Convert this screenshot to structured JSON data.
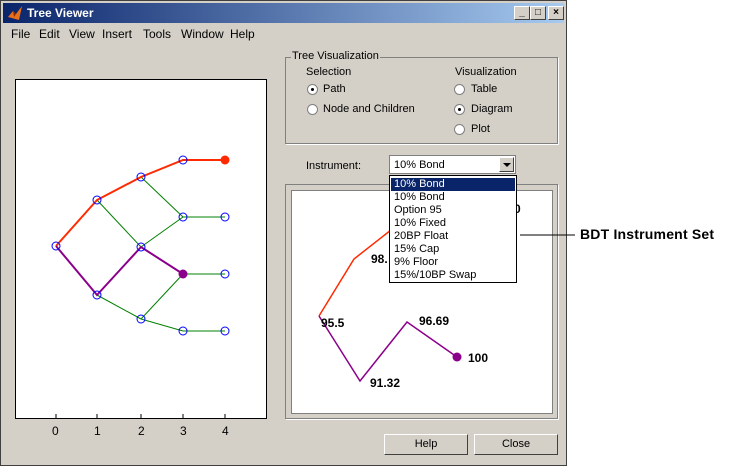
{
  "window": {
    "title": "Tree Viewer",
    "controls": [
      "_",
      "□",
      "×"
    ]
  },
  "menu": [
    "File",
    "Edit",
    "View",
    "Insert",
    "Tools",
    "Window",
    "Help"
  ],
  "tree_visualization": {
    "title": "Tree Visualization",
    "selection": {
      "label": "Selection",
      "options": [
        "Path",
        "Node and Children"
      ],
      "selected": "Path"
    },
    "visualization": {
      "label": "Visualization",
      "options": [
        "Table",
        "Diagram",
        "Plot"
      ],
      "selected": "Diagram"
    }
  },
  "instrument": {
    "label": "Instrument:",
    "value": "10% Bond",
    "options": [
      "10% Bond",
      "10% Bond",
      "Option 95",
      "10% Fixed",
      "20BP Float",
      "15% Cap",
      "9% Floor",
      "15%/10BP Swap"
    ],
    "highlighted_index": 0
  },
  "tree_plot": {
    "x_ticks": [
      "0",
      "1",
      "2",
      "3",
      "4"
    ]
  },
  "path_diagram": {
    "labels": [
      "95.5",
      "98.",
      "0",
      "91.32",
      "96.69",
      "100"
    ]
  },
  "buttons": {
    "help": "Help",
    "close": "Close"
  },
  "callout": "BDT Instrument Set",
  "colors": {
    "title_gradient_start": "#0a246a",
    "title_gradient_end": "#a6caf0",
    "window_face": "#d4d0c8",
    "path_red": "#ff2a00",
    "branch_green": "#008000",
    "node_blue": "#0000ff",
    "path_purple": "#8b008b"
  }
}
